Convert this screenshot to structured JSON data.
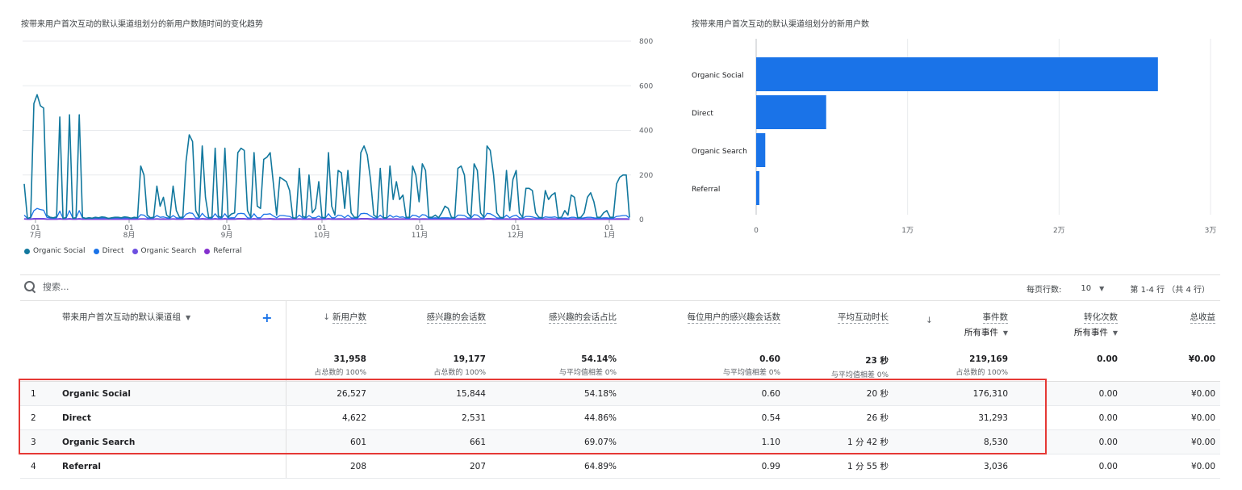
{
  "line_card": {
    "title": "按带来用户首次互动的默认渠道组划分的新用户数随时间的变化趋势",
    "legend": [
      {
        "label": "Organic Social",
        "color": "#12789e"
      },
      {
        "label": "Direct",
        "color": "#1a73e8"
      },
      {
        "label": "Organic Search",
        "color": "#6d4fe0"
      },
      {
        "label": "Referral",
        "color": "#8430ce"
      }
    ]
  },
  "bar_card": {
    "title": "按带来用户首次互动的默认渠道组划分的新用户数"
  },
  "chart_data": [
    {
      "type": "line",
      "y_ticks": [
        "800",
        "600",
        "400",
        "200",
        "0"
      ],
      "ylim": [
        0,
        800
      ],
      "x_ticks": [
        {
          "day": "01",
          "month": "7月"
        },
        {
          "day": "01",
          "month": "8月"
        },
        {
          "day": "01",
          "month": "9月"
        },
        {
          "day": "01",
          "month": "10月"
        },
        {
          "day": "01",
          "month": "11月"
        },
        {
          "day": "01",
          "month": "12月"
        },
        {
          "day": "01",
          "month": "1月"
        }
      ],
      "series": [
        {
          "name": "Organic Social",
          "color": "#12789e",
          "values": [
            160,
            5,
            10,
            520,
            560,
            510,
            500,
            20,
            10,
            8,
            12,
            460,
            5,
            10,
            470,
            6,
            8,
            470,
            10,
            5,
            8,
            6,
            10,
            8,
            12,
            10,
            5,
            8,
            10,
            10,
            8,
            12,
            10,
            6,
            10,
            8,
            240,
            200,
            20,
            8,
            10,
            150,
            60,
            100,
            20,
            8,
            150,
            40,
            10,
            10,
            260,
            380,
            350,
            40,
            10,
            330,
            100,
            8,
            10,
            320,
            15,
            10,
            320,
            10,
            25,
            30,
            300,
            320,
            310,
            40,
            10,
            300,
            60,
            50,
            270,
            280,
            300,
            160,
            20,
            190,
            180,
            170,
            130,
            8,
            6,
            230,
            15,
            10,
            200,
            30,
            50,
            170,
            10,
            8,
            300,
            60,
            20,
            220,
            210,
            50,
            220,
            30,
            10,
            10,
            300,
            330,
            290,
            180,
            20,
            10,
            230,
            8,
            8,
            240,
            90,
            170,
            90,
            110,
            10,
            10,
            240,
            200,
            80,
            250,
            220,
            10,
            10,
            20,
            8,
            30,
            60,
            50,
            10,
            8,
            230,
            240,
            200,
            30,
            10,
            250,
            220,
            30,
            10,
            330,
            310,
            200,
            30,
            10,
            8,
            220,
            40,
            180,
            220,
            30,
            10,
            140,
            140,
            130,
            30,
            10,
            8,
            130,
            90,
            110,
            120,
            8,
            10,
            40,
            20,
            110,
            100,
            8,
            10,
            30,
            100,
            120,
            80,
            10,
            10,
            30,
            40,
            10,
            10,
            160,
            190,
            200,
            200,
            10
          ]
        },
        {
          "name": "Direct",
          "color": "#1a73e8",
          "values": [
            20,
            5,
            8,
            40,
            50,
            45,
            42,
            10,
            8,
            6,
            8,
            38,
            6,
            8,
            40,
            6,
            8,
            40,
            8,
            6,
            8,
            6,
            8,
            6,
            8,
            8,
            6,
            6,
            8,
            8,
            6,
            8,
            8,
            6,
            8,
            6,
            22,
            20,
            8,
            6,
            8,
            18,
            10,
            12,
            8,
            6,
            18,
            8,
            6,
            6,
            24,
            30,
            28,
            8,
            6,
            28,
            12,
            6,
            6,
            26,
            8,
            6,
            26,
            6,
            8,
            8,
            26,
            28,
            26,
            8,
            6,
            26,
            8,
            8,
            24,
            24,
            26,
            16,
            8,
            18,
            18,
            16,
            14,
            6,
            6,
            20,
            8,
            6,
            18,
            8,
            8,
            16,
            6,
            6,
            26,
            8,
            8,
            20,
            18,
            8,
            20,
            8,
            6,
            6,
            26,
            28,
            26,
            16,
            8,
            6,
            20,
            6,
            6,
            20,
            10,
            16,
            10,
            12,
            6,
            6,
            20,
            18,
            10,
            22,
            20,
            6,
            6,
            8,
            6,
            8,
            8,
            8,
            6,
            6,
            20,
            20,
            18,
            8,
            6,
            22,
            20,
            8,
            6,
            28,
            26,
            18,
            8,
            6,
            6,
            20,
            8,
            16,
            20,
            8,
            6,
            14,
            14,
            12,
            8,
            6,
            6,
            12,
            10,
            10,
            12,
            6,
            6,
            8,
            6,
            10,
            10,
            6,
            6,
            8,
            10,
            10,
            8,
            6,
            6,
            8,
            8,
            6,
            6,
            14,
            16,
            18,
            18,
            6
          ]
        },
        {
          "name": "Organic Search",
          "color": "#6d4fe0",
          "values": [
            4,
            3,
            3,
            5,
            5,
            5,
            5,
            3,
            3,
            3,
            3,
            5,
            3,
            3,
            5,
            3,
            3,
            5,
            3,
            3,
            3,
            3,
            3,
            3,
            3,
            3,
            3,
            3,
            3,
            3,
            3,
            3,
            3,
            3,
            3,
            3,
            4,
            4,
            3,
            3,
            3,
            4,
            3,
            4,
            3,
            3,
            4,
            3,
            3,
            3,
            4,
            5,
            5,
            3,
            3,
            5,
            4,
            3,
            3,
            5,
            3,
            3,
            5,
            3,
            3,
            3,
            5,
            5,
            5,
            3,
            3,
            5,
            3,
            3,
            4,
            4,
            5,
            4,
            3,
            4,
            4,
            4,
            4,
            3,
            3,
            4,
            3,
            3,
            4,
            3,
            3,
            4,
            3,
            3,
            5,
            3,
            3,
            4,
            4,
            3,
            4,
            3,
            3,
            3,
            5,
            5,
            5,
            4,
            3,
            3,
            4,
            3,
            3,
            4,
            3,
            4,
            3,
            4,
            3,
            3,
            4,
            4,
            3,
            4,
            4,
            3,
            3,
            3,
            3,
            3,
            3,
            3,
            3,
            3,
            4,
            4,
            4,
            3,
            3,
            4,
            4,
            3,
            3,
            5,
            5,
            4,
            3,
            3,
            3,
            4,
            3,
            4,
            4,
            3,
            3,
            4,
            4,
            4,
            3,
            3,
            3,
            4,
            3,
            4,
            4,
            3,
            3,
            3,
            3,
            4,
            4,
            3,
            3,
            3,
            4,
            4,
            3,
            3,
            3,
            3,
            3,
            3,
            3,
            4,
            4,
            4,
            4,
            3
          ]
        },
        {
          "name": "Referral",
          "color": "#8430ce",
          "values": [
            2,
            1,
            1,
            2,
            2,
            2,
            2,
            1,
            1,
            1,
            1,
            2,
            1,
            1,
            2,
            1,
            1,
            2,
            1,
            1,
            1,
            1,
            1,
            1,
            1,
            1,
            1,
            1,
            1,
            1,
            1,
            1,
            1,
            1,
            1,
            1,
            2,
            2,
            1,
            1,
            1,
            2,
            1,
            1,
            1,
            1,
            2,
            1,
            1,
            1,
            2,
            2,
            2,
            1,
            1,
            2,
            1,
            1,
            1,
            2,
            1,
            1,
            2,
            1,
            1,
            1,
            2,
            2,
            2,
            1,
            1,
            2,
            1,
            1,
            2,
            2,
            2,
            1,
            1,
            1,
            1,
            1,
            1,
            1,
            1,
            2,
            1,
            1,
            1,
            1,
            1,
            1,
            1,
            1,
            2,
            1,
            1,
            1,
            1,
            1,
            1,
            1,
            1,
            1,
            2,
            2,
            2,
            1,
            1,
            1,
            1,
            1,
            1,
            1,
            1,
            1,
            1,
            1,
            1,
            1,
            1,
            1,
            1,
            1,
            1,
            1,
            1,
            1,
            1,
            1,
            1,
            1,
            1,
            1,
            1,
            1,
            1,
            1,
            1,
            1,
            1,
            1,
            1,
            2,
            2,
            1,
            1,
            1,
            1,
            1,
            1,
            1,
            1,
            1,
            1,
            1,
            1,
            1,
            1,
            1,
            1,
            1,
            1,
            1,
            1,
            1,
            1,
            1,
            1,
            1,
            1,
            1,
            1,
            1,
            1,
            1,
            1,
            1,
            1,
            1,
            1,
            1,
            1,
            1,
            1,
            1,
            1,
            1
          ]
        }
      ]
    },
    {
      "type": "bar",
      "orientation": "horizontal",
      "categories": [
        "Organic Social",
        "Direct",
        "Organic Search",
        "Referral"
      ],
      "values": [
        26527,
        4622,
        601,
        208
      ],
      "xlim": [
        0,
        30000
      ],
      "x_ticks": [
        {
          "value": 0,
          "label": "0"
        },
        {
          "value": 10000,
          "label": "1万"
        },
        {
          "value": 20000,
          "label": "2万"
        },
        {
          "value": 30000,
          "label": "3万"
        }
      ],
      "bar_color": "#1a73e8"
    }
  ],
  "toolbar": {
    "search_placeholder": "搜索...",
    "rows_label": "每页行数:",
    "rows_value": "10",
    "page_info": "第 1-4 行 （共 4 行）"
  },
  "table": {
    "dimension_header": "带来用户首次互动的默认渠道组",
    "columns": [
      {
        "label": "新用户数",
        "total": "31,958",
        "sub": "占总数的 100%"
      },
      {
        "label": "感兴趣的会话数",
        "total": "19,177",
        "sub": "占总数的 100%"
      },
      {
        "label": "感兴趣的会话占比",
        "total": "54.14%",
        "sub": "与平均值相差 0%"
      },
      {
        "label": "每位用户的感兴趣会话数",
        "total": "0.60",
        "sub": "与平均值相差 0%"
      },
      {
        "label": "平均互动时长",
        "total": "23 秒",
        "sub": "与平均值相差 0%"
      },
      {
        "label": "事件数",
        "selector": "所有事件",
        "total": "219,169",
        "sub": "占总数的 100%"
      },
      {
        "label": "转化次数",
        "selector": "所有事件",
        "total": "0.00",
        "sub": ""
      },
      {
        "label": "总收益",
        "total": "¥0.00",
        "sub": ""
      }
    ],
    "rows": [
      {
        "index": "1",
        "channel": "Organic Social",
        "cells": [
          "26,527",
          "15,844",
          "54.18%",
          "0.60",
          "20 秒",
          "176,310",
          "0.00",
          "¥0.00"
        ]
      },
      {
        "index": "2",
        "channel": "Direct",
        "cells": [
          "4,622",
          "2,531",
          "44.86%",
          "0.54",
          "26 秒",
          "31,293",
          "0.00",
          "¥0.00"
        ]
      },
      {
        "index": "3",
        "channel": "Organic Search",
        "cells": [
          "601",
          "661",
          "69.07%",
          "1.10",
          "1 分 42 秒",
          "8,530",
          "0.00",
          "¥0.00"
        ]
      },
      {
        "index": "4",
        "channel": "Referral",
        "cells": [
          "208",
          "207",
          "64.89%",
          "0.99",
          "1 分 55 秒",
          "3,036",
          "0.00",
          "¥0.00"
        ]
      }
    ]
  }
}
